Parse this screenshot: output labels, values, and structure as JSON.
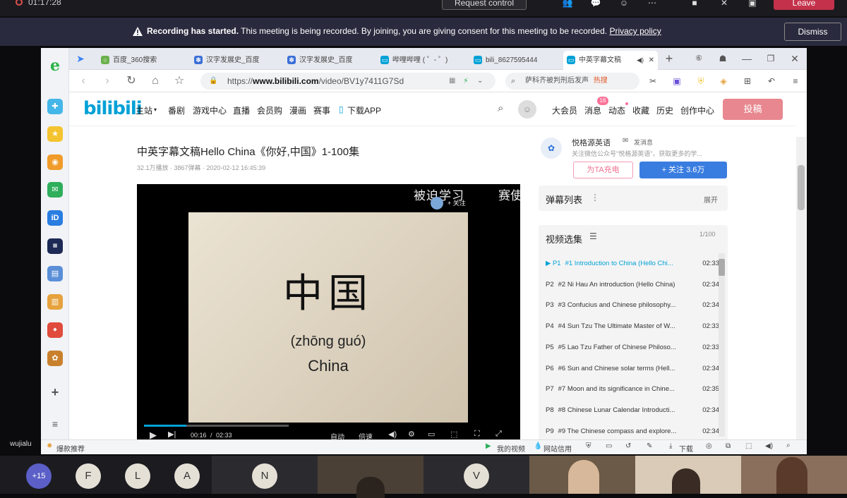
{
  "teams": {
    "timer": "01:17:28",
    "request_control": "Request control",
    "leave": "Leave",
    "banner_bold": "Recording has started.",
    "banner_text": "This meeting is being recorded. By joining, you are giving consent for this meeting to be recorded.",
    "banner_link": "Privacy policy",
    "dismiss": "Dismiss",
    "presenter_name": "wujialu",
    "overflow_count": "+15",
    "participants": [
      "F",
      "L",
      "A",
      "N",
      "V"
    ]
  },
  "browser": {
    "tabs": [
      {
        "label": "百度_360搜索",
        "icon": "360-icon",
        "color": "#6ab04c"
      },
      {
        "label": "汉字发展史_百度",
        "icon": "paw-icon",
        "color": "#3b6fd8"
      },
      {
        "label": "汉字发展史_百度",
        "icon": "paw-icon",
        "color": "#3b6fd8"
      },
      {
        "label": "哔哩哔哩 ( ゜- ゜)",
        "icon": "tv-icon",
        "color": "#00a1d6"
      },
      {
        "label": "bili_8627595444",
        "icon": "tv-icon",
        "color": "#00a1d6"
      },
      {
        "label": "中英字幕文稿",
        "icon": "tv-icon",
        "color": "#00a1d6"
      }
    ],
    "url_prefix": "https://",
    "url_domain": "www.bilibili.com",
    "url_path": "/video/BV1y7411G7Sd",
    "search_text": "萨科齐被判刑后发声",
    "hot_label": "热搜"
  },
  "bili": {
    "logo": "bilibili",
    "nav": [
      "主站",
      "番剧",
      "游戏中心",
      "直播",
      "会员购",
      "漫画",
      "赛事",
      "下载APP"
    ],
    "right_nav": [
      "大会员",
      "消息",
      "动态",
      "收藏",
      "历史",
      "创作中心"
    ],
    "msg_badge": "16",
    "post_button": "投稿",
    "video_title": "中英字幕文稿Hello China《你好,中国》1-100集",
    "video_meta": "32.1万播放 · 3867弹幕 · 2020-02-12 16:45:39",
    "uploader": "悦格源英语",
    "send_msg": "发消息",
    "uploader_desc": "关注微信公众号\"悦格源英语\"，获取更多的学...",
    "charge": "为TA充电",
    "follow": "+ 关注 3.6万",
    "danmaku_title": "弹幕列表",
    "expand": "展开",
    "playlist_title": "视频选集",
    "playlist_count": "1/100",
    "watermark": "被迫学习",
    "watermark_follow": "+ 关注",
    "watermark_more": "赛使",
    "slide_hanzi": "中国",
    "slide_pinyin": "(zhōng guó)",
    "slide_english": "China",
    "time_current": "00:16",
    "time_total": "02:33",
    "ctl_auto": "自动",
    "ctl_speed": "倍速",
    "episodes": [
      {
        "p": "P1",
        "title": "#1 Introduction to China (Hello Chi...",
        "dur": "02:33",
        "active": true
      },
      {
        "p": "P2",
        "title": "#2 Ni Hau An introduction (Hello China)",
        "dur": "02:34"
      },
      {
        "p": "P3",
        "title": "#3 Confucius and Chinese philosophy...",
        "dur": "02:34"
      },
      {
        "p": "P4",
        "title": "#4 Sun Tzu The Ultimate Master of W...",
        "dur": "02:33"
      },
      {
        "p": "P5",
        "title": "#5 Lao Tzu Father of Chinese Philoso...",
        "dur": "02:33"
      },
      {
        "p": "P6",
        "title": "#6 Sun and Chinese solar terms (Hell...",
        "dur": "02:34"
      },
      {
        "p": "P7",
        "title": "#7 Moon and its significance in Chine...",
        "dur": "02:35"
      },
      {
        "p": "P8",
        "title": "#8 Chinese Lunar Calendar Introducti...",
        "dur": "02:34"
      },
      {
        "p": "P9",
        "title": "#9 The Chinese compass and explore...",
        "dur": "02:34"
      }
    ],
    "status_left": "爆款推荐",
    "status_items": [
      "我的视频",
      "网站信用",
      "下载"
    ]
  }
}
